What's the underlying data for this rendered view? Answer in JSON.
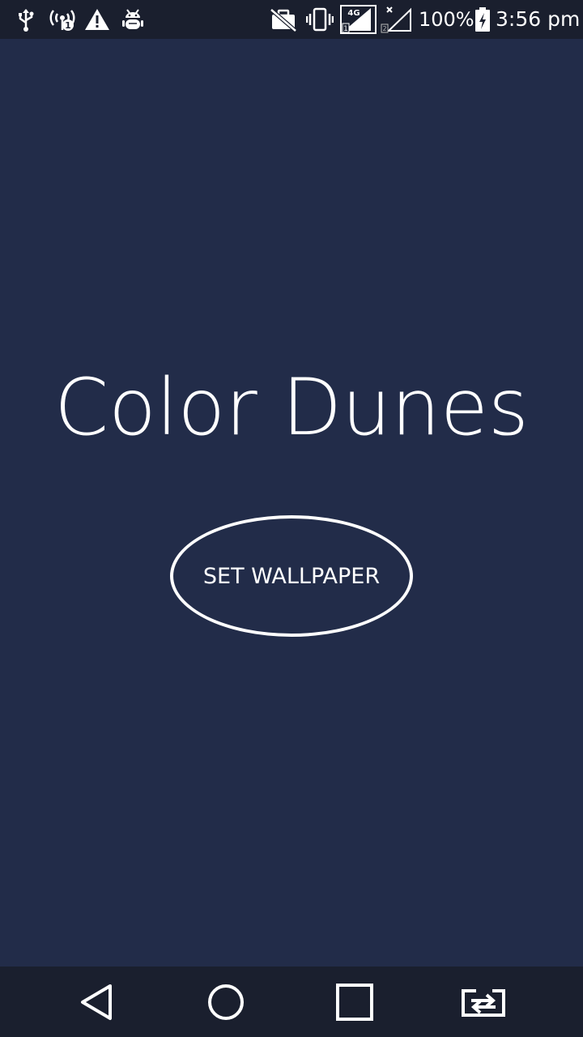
{
  "status_bar": {
    "icons_left": [
      "usb-icon",
      "hotspot-icon",
      "warning-icon",
      "android-debug-icon"
    ],
    "icons_right": [
      "no-sim-briefcase-icon",
      "vibrate-icon",
      "signal-4g-sim1-icon",
      "signal-sim2-icon",
      "battery-charging-icon"
    ],
    "network_label": "4G",
    "battery_percent": "100%",
    "time": "3:56 pm"
  },
  "main": {
    "title": "Color Dunes",
    "set_wallpaper_label": "SET WALLPAPER"
  },
  "nav_bar": {
    "buttons": [
      "back-icon",
      "home-icon",
      "recents-icon",
      "switch-icon"
    ]
  },
  "colors": {
    "background": "#222c49",
    "bars": "#1a1f2e",
    "foreground": "#ffffff"
  }
}
